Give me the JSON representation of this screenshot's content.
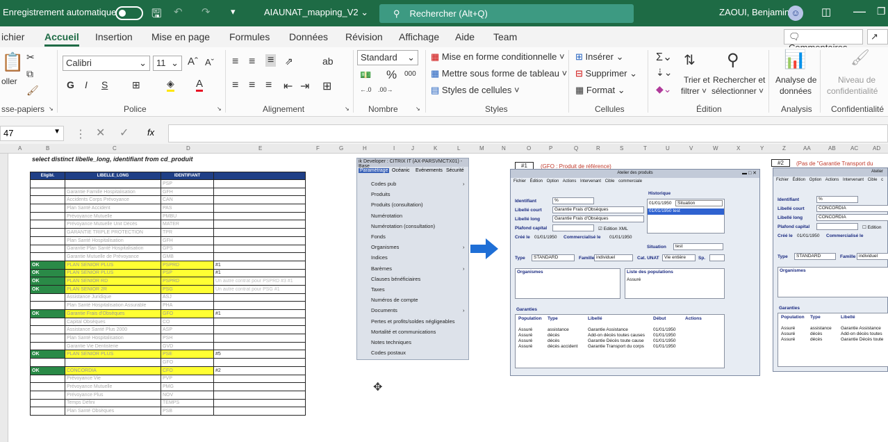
{
  "titlebar": {
    "autosave_label": "Enregistrement automatique",
    "filename": "AIAUNAT_mapping_V2 ⌄",
    "search_placeholder": "Rechercher (Alt+Q)",
    "user": "ZAOUI, Benjamin"
  },
  "menu": {
    "items": [
      "ichier",
      "Accueil",
      "Insertion",
      "Mise en page",
      "Formules",
      "Données",
      "Révision",
      "Affichage",
      "Aide",
      "Team"
    ],
    "comments_label": "Commentaires"
  },
  "ribbon": {
    "clipboard": {
      "paste": "oller",
      "label": "sse-papiers"
    },
    "font": {
      "name": "Calibri",
      "size": "11",
      "label": "Police"
    },
    "alignment": {
      "label": "Alignement"
    },
    "number": {
      "format": "Standard",
      "label": "Nombre"
    },
    "styles": {
      "conditional": "Mise en forme conditionnelle ˅",
      "table": "Mettre sous forme de tableau ˅",
      "cell_styles": "Styles de cellules ˅",
      "label": "Styles"
    },
    "cells": {
      "insert": "Insérer",
      "delete": "Supprimer",
      "format": "Format",
      "label": "Cellules"
    },
    "editing": {
      "sort1": "Trier et",
      "sort2": "filtrer ˅",
      "find1": "Rechercher et",
      "find2": "sélectionner ˅",
      "label": "Édition"
    },
    "analysis": {
      "btn1": "Analyse de",
      "btn2": "données",
      "label": "Analysis"
    },
    "confidentiality": {
      "btn1": "Niveau de",
      "btn2": "confidentialité",
      "label": "Confidentialité"
    }
  },
  "formula_bar": {
    "cell_ref": "47",
    "fx": "fx"
  },
  "sheet": {
    "columns": [
      "A",
      "B",
      "C",
      "D",
      "E",
      "F",
      "G",
      "H",
      "I",
      "J",
      "K",
      "L",
      "M",
      "N",
      "O",
      "P",
      "Q",
      "R",
      "S",
      "T",
      "U",
      "V",
      "W",
      "X",
      "Y",
      "Z",
      "AA",
      "AB",
      "AC",
      "AD"
    ],
    "sql": "select distinct libelle_long, identifiant from cd_produit",
    "headers": [
      "Eligibl.",
      "LIBELLE_LONG",
      "IDENTIFIANT",
      ""
    ],
    "rows": [
      [
        "",
        "",
        "PSP",
        ""
      ],
      [
        "",
        "Garantie Famille Hospitalisation",
        "GFH",
        ""
      ],
      [
        "",
        "Accidents Corps Prévoyance",
        "CAN",
        ""
      ],
      [
        "",
        "Plan Santé Accident",
        "PAS",
        ""
      ],
      [
        "",
        "Prévoyance Mutuelle",
        "PMBU",
        ""
      ],
      [
        "",
        "Prévoyance Mutuelle Unit Décès",
        "MATER",
        ""
      ],
      [
        "",
        "GARANTIE TRIPLE PROTECTION",
        "TPR",
        ""
      ],
      [
        "",
        "Plan Santé Hospitalisation",
        "GFH",
        ""
      ],
      [
        "",
        "Garantie Plan Santé Hospitalisation",
        "GPS",
        ""
      ],
      [
        "",
        "Garantie Mutuelle de Prévoyance",
        "GMB",
        ""
      ],
      [
        "OK",
        "PLAN SENIOR PLUS",
        "PSPRD",
        "#1"
      ],
      [
        "OK",
        "PLAN SENIOR PLUS",
        "PSP",
        "#1"
      ],
      [
        "OK",
        "PLAN SENIOR RD",
        "PSPRD",
        "Un autre contrat pour PSPRD #3 #1"
      ],
      [
        "OK",
        "PLAN SENIOR 2R",
        "PSG",
        "Un autre contrat pour PSG #1"
      ],
      [
        "",
        "Assistance Juridique",
        "ASJ",
        ""
      ],
      [
        "",
        "Plan Santé Hospitalisation Assurable",
        "PHA",
        ""
      ],
      [
        "OK",
        "Garantie Frais d'Obsèques",
        "GFO",
        "#1"
      ],
      [
        "",
        "Capital Obsèques",
        "CO",
        ""
      ],
      [
        "",
        "Assistance Santé Plus 2000",
        "ASP",
        ""
      ],
      [
        "",
        "Plan Santé Hospitalisation",
        "PSH",
        ""
      ],
      [
        "",
        "Garantie Vie Dentisterie",
        "GVD",
        ""
      ],
      [
        "OK",
        "PLAN SENIOR PLUS",
        "PSE",
        "#5"
      ],
      [
        "",
        "",
        "GFO",
        ""
      ],
      [
        "OK",
        "CONCORDIA",
        "CFO",
        "#2"
      ],
      [
        "",
        "Prévoyance Vie",
        "PVP",
        ""
      ],
      [
        "",
        "Prévoyance Mutuelle",
        "PMG",
        ""
      ],
      [
        "",
        "Prévoyance Plus",
        "NOV",
        ""
      ],
      [
        "",
        "Temps Défini",
        "TEMPS",
        ""
      ],
      [
        "",
        "Plan Santé Obsèques",
        "PSB",
        ""
      ]
    ]
  },
  "citrix_menu": {
    "title": "ik Developer : CITRIX IT (AX-PARSVMCTX01) - Base",
    "menubar": [
      "Paramétrage",
      "Océanic",
      "Evénements",
      "Sécurité"
    ],
    "items": [
      "Codes pub",
      "Produits",
      "Produits (consultation)",
      "Numérotation",
      "Numérotation (consultation)",
      "Fonds",
      "Organismes",
      "Indices",
      "Barèmes",
      "Clauses bénéficiaires",
      "Taxes",
      "Numéros de compte",
      "Documents",
      "Pertes et profits/soldes négligeables",
      "Mortalité et communications",
      "Notes techniques",
      "Codes postaux"
    ]
  },
  "product_window_1": {
    "tag": "#1",
    "note": "(GFO : Produit de référence)",
    "title": "Atelier des produits",
    "menu": "Fichier Édition Option Actions Intervenant Cible commerciale",
    "identifiant": "%",
    "libelle_court": "Garantie Frais d'Obsèques",
    "libelle_long": "Garantie Frais d'Obsèques",
    "edition_xml": "Edition XML",
    "cree_le": "01/01/1950",
    "commercialise_le": "01/01/1950",
    "historique_label": "Historique",
    "hist_date": "01/01/1950",
    "hist_situation": "Situation",
    "hist_row": "01/01/1950  test",
    "situation_val": "test",
    "type_val": "STANDARD",
    "famille_val": "individuel",
    "cat_unat": "Vie entière",
    "organismes_label": "Organismes",
    "populations_label": "Liste des populations",
    "population_val": "Assuré",
    "garanties_label": "Garanties",
    "garanties_headers": [
      "Population",
      "Type",
      "Libellé",
      "Début",
      "Actions"
    ],
    "garanties": [
      [
        "Assuré",
        "assistance",
        "Garantie Assistance",
        "01/01/1950"
      ],
      [
        "Assuré",
        "décès",
        "Add-on décès toutes causes",
        "01/01/1950"
      ],
      [
        "Assuré",
        "décès",
        "Garantie Décès toute cause",
        "01/01/1950"
      ],
      [
        "Assuré",
        "décès accident",
        "Garantie Transport du corps",
        "01/01/1950"
      ]
    ]
  },
  "product_window_2": {
    "tag": "#2",
    "note": "(Pas de \"Garantie Transport du corps\")",
    "title": "Atelier",
    "menu": "Fichier Édition Option Actions Intervenant Cible c",
    "identifiant": "%",
    "libelle_court": "CONCORDIA",
    "libelle_long": "CONCORDIA",
    "cree_le": "01/01/1950",
    "type_val": "STANDARD",
    "famille_val": "individuel",
    "garanties": [
      [
        "Assuré",
        "assistance",
        "Garantie Assistance"
      ],
      [
        "Assuré",
        "décès",
        "Add-on décès toutes"
      ],
      [
        "Assuré",
        "décès",
        "Garantie Décès toute"
      ]
    ]
  }
}
